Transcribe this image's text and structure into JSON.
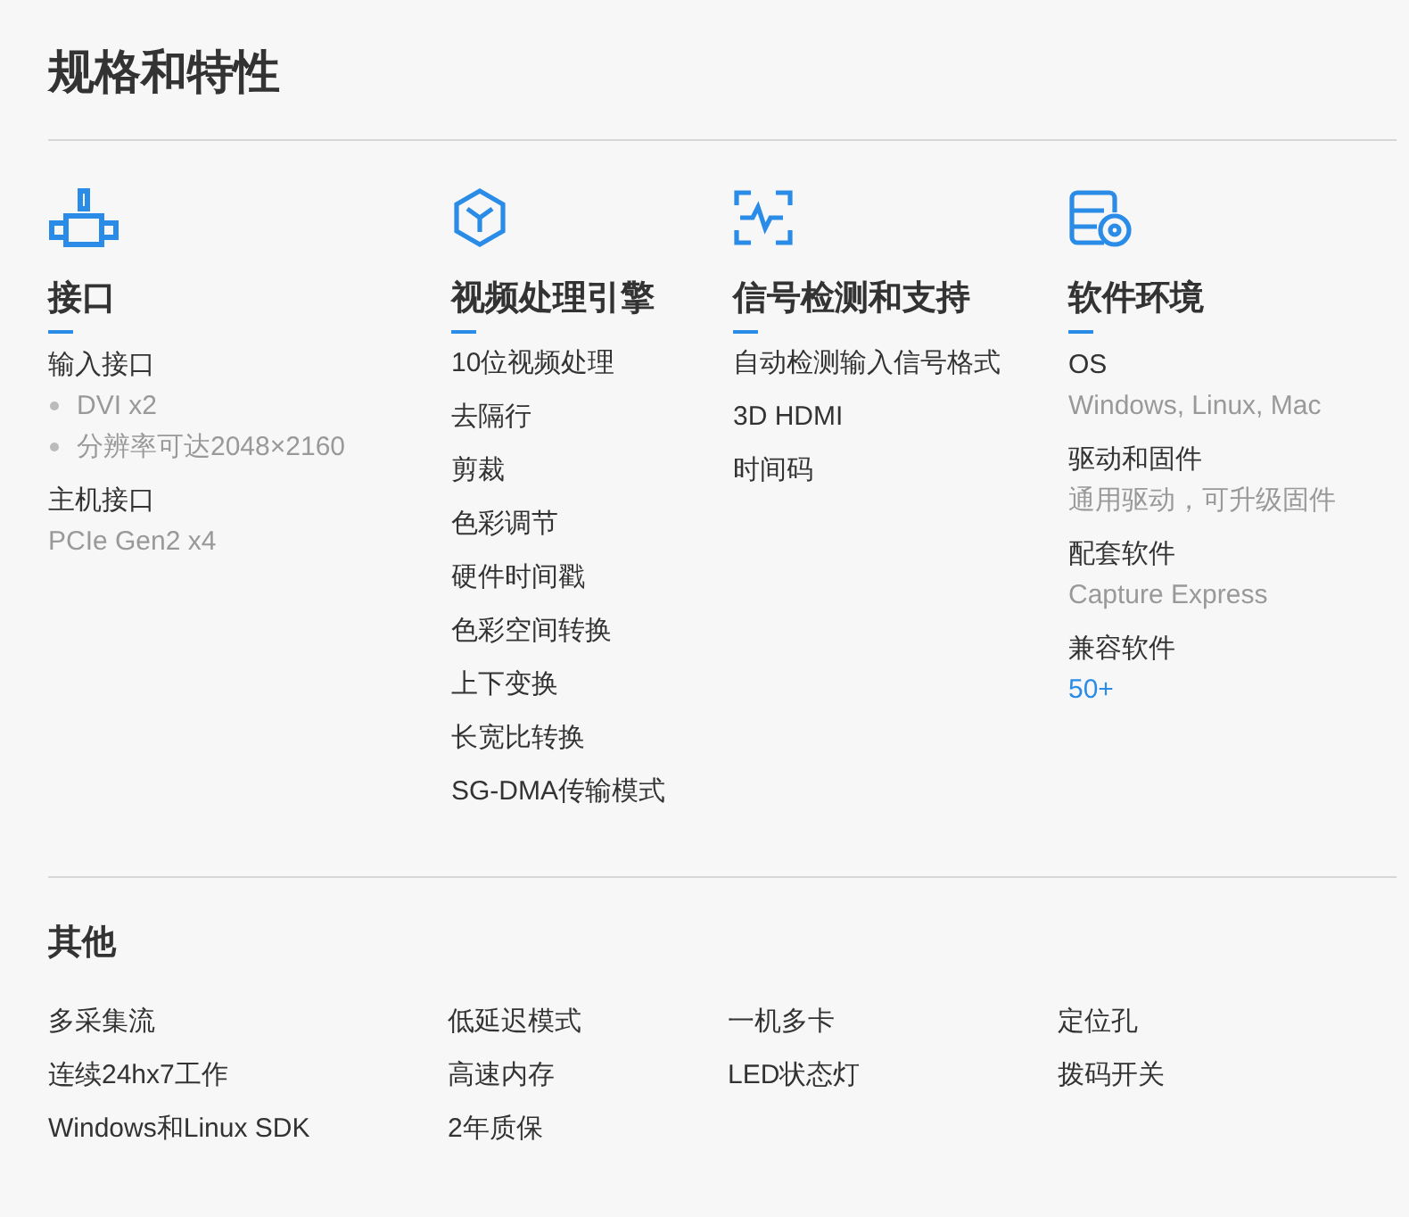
{
  "title": "规格和特性",
  "features": [
    {
      "kind": "connector",
      "title": "接口",
      "items": [
        {
          "kind": "label",
          "text": "输入接口"
        },
        {
          "kind": "bullet",
          "text": "DVI x2"
        },
        {
          "kind": "bullet",
          "text": "分辨率可达2048×2160"
        },
        {
          "kind": "label",
          "text": "主机接口"
        },
        {
          "kind": "value",
          "text": "PCIe Gen2 x4"
        }
      ]
    },
    {
      "kind": "cube",
      "title": "视频处理引擎",
      "items": [
        {
          "kind": "plain",
          "text": "10位视频处理"
        },
        {
          "kind": "plain",
          "text": "去隔行"
        },
        {
          "kind": "plain",
          "text": "剪裁"
        },
        {
          "kind": "plain",
          "text": "色彩调节"
        },
        {
          "kind": "plain",
          "text": "硬件时间戳"
        },
        {
          "kind": "plain",
          "text": "色彩空间转换"
        },
        {
          "kind": "plain",
          "text": "上下变换"
        },
        {
          "kind": "plain",
          "text": "长宽比转换"
        },
        {
          "kind": "plain",
          "text": "SG-DMA传输模式"
        }
      ]
    },
    {
      "kind": "signal",
      "title": "信号检测和支持",
      "items": [
        {
          "kind": "plain",
          "text": "自动检测输入信号格式"
        },
        {
          "kind": "plain",
          "text": "3D HDMI"
        },
        {
          "kind": "plain",
          "text": "时间码"
        }
      ]
    },
    {
      "kind": "disk",
      "title": "软件环境",
      "items": [
        {
          "kind": "label",
          "text": "OS"
        },
        {
          "kind": "value",
          "text": "Windows, Linux, Mac"
        },
        {
          "kind": "label",
          "text": "驱动和固件"
        },
        {
          "kind": "value",
          "text": "通用驱动，可升级固件"
        },
        {
          "kind": "label",
          "text": "配套软件"
        },
        {
          "kind": "value",
          "text": "Capture Express"
        },
        {
          "kind": "label",
          "text": "兼容软件"
        },
        {
          "kind": "link",
          "text": "50+"
        }
      ]
    }
  ],
  "other": {
    "title": "其他",
    "columns": [
      [
        "多采集流",
        "连续24hx7工作",
        "Windows和Linux SDK"
      ],
      [
        "低延迟模式",
        "高速内存",
        "2年质保"
      ],
      [
        "一机多卡",
        "LED状态灯"
      ],
      [
        "定位孔",
        "拨码开关"
      ]
    ]
  }
}
